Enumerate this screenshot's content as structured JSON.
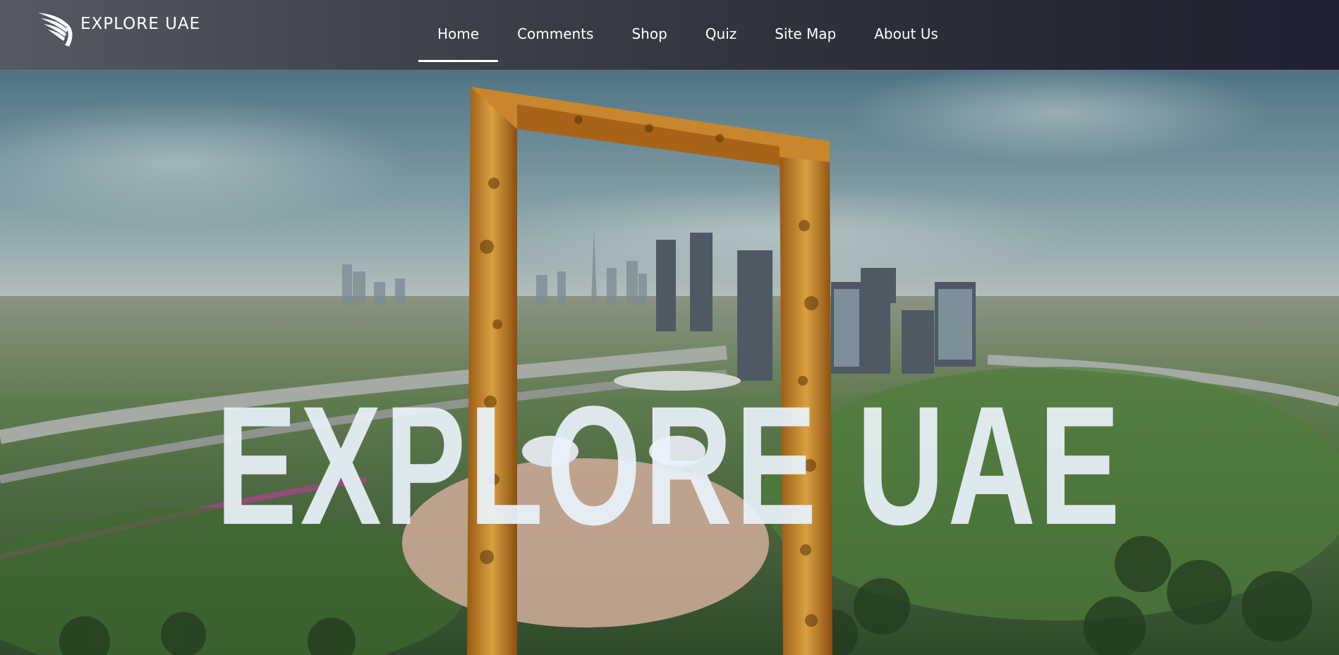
{
  "brand": {
    "name": "EXPLORE UAE",
    "logo_icon": "wing-logo-icon"
  },
  "nav": {
    "items": [
      {
        "label": "Home",
        "active": true
      },
      {
        "label": "Comments",
        "active": false
      },
      {
        "label": "Shop",
        "active": false
      },
      {
        "label": "Quiz",
        "active": false
      },
      {
        "label": "Site Map",
        "active": false
      },
      {
        "label": "About Us",
        "active": false
      }
    ]
  },
  "hero": {
    "title": "EXPLORE UAE"
  },
  "colors": {
    "header_bg": "#2a2c38",
    "frame_gold": "#c8852a",
    "title": "#e8f2fa"
  }
}
